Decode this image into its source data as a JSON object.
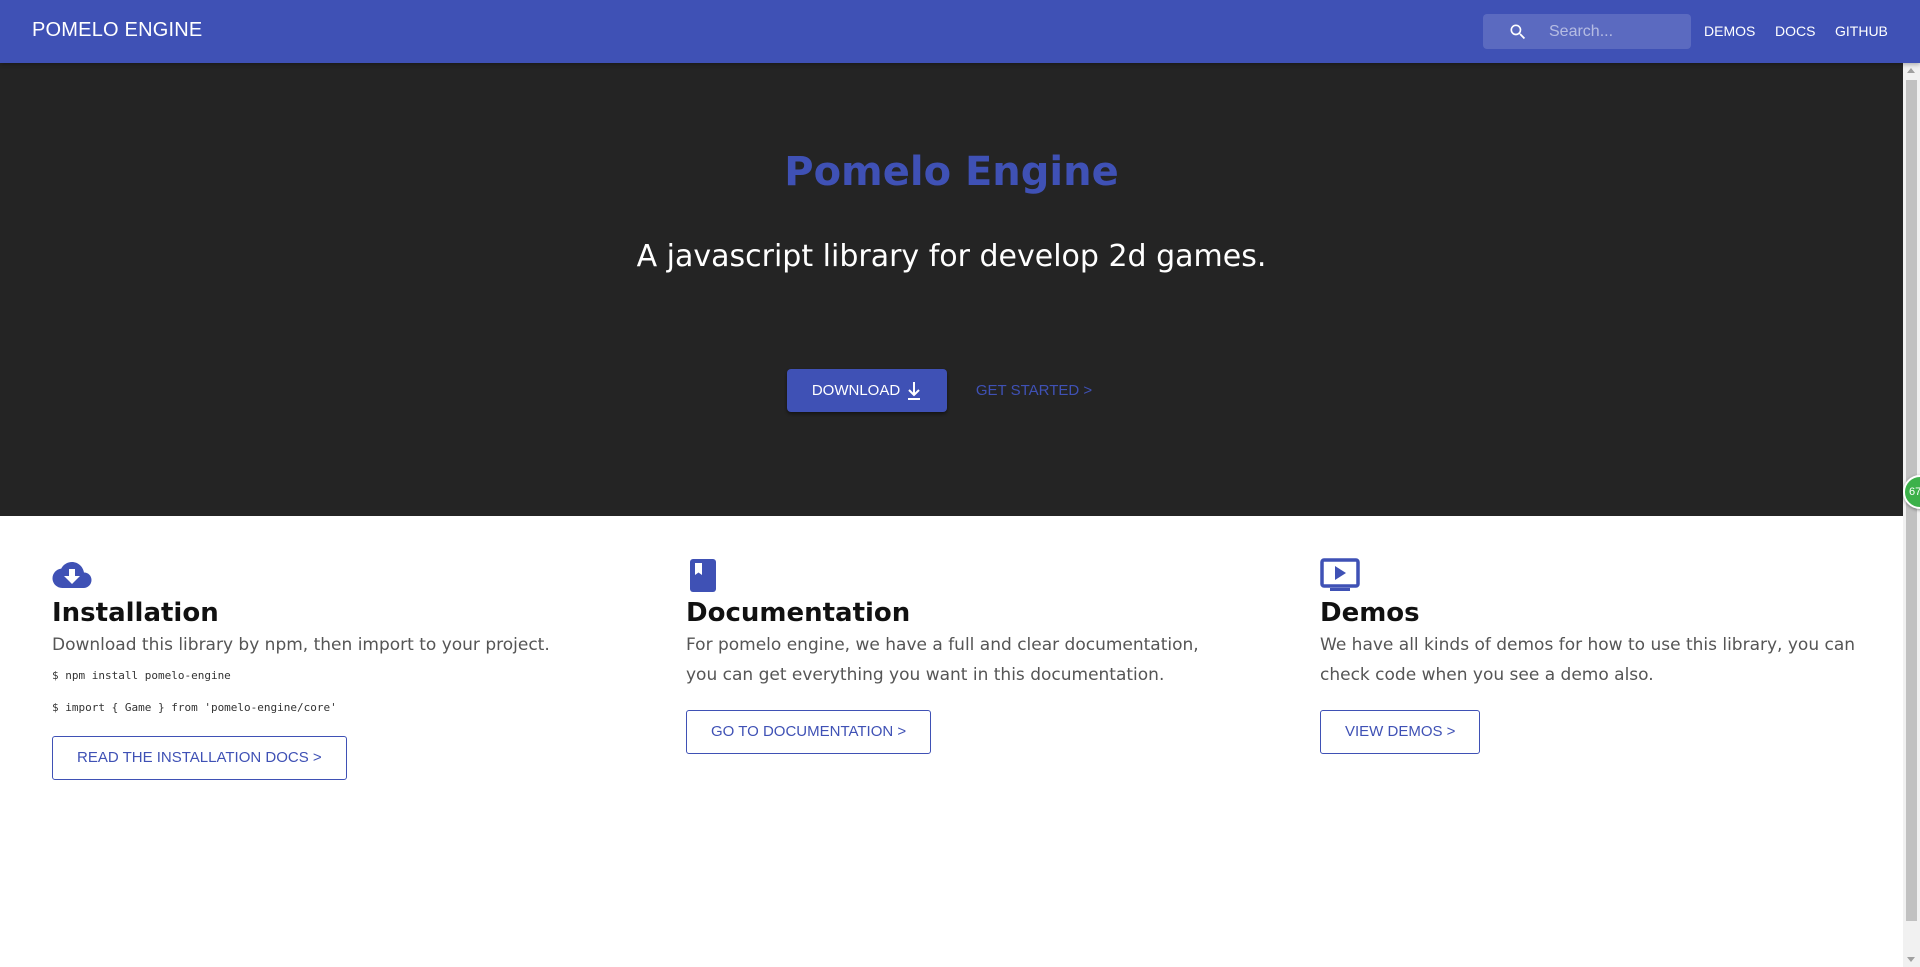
{
  "header": {
    "brand": "POMELO ENGINE",
    "search_placeholder": "Search...",
    "nav": [
      "DEMOS",
      "DOCS",
      "GITHUB"
    ]
  },
  "hero": {
    "title": "Pomelo Engine",
    "subtitle": "A javascript library for develop 2d games.",
    "download_label": "DOWNLOAD",
    "get_started_label": "GET STARTED >"
  },
  "features": [
    {
      "icon": "cloud-download-icon",
      "title": "Installation",
      "description": "Download this library by npm, then import to your project.",
      "code": [
        "$ npm install pomelo-engine",
        "$ import { Game } from 'pomelo-engine/core'"
      ],
      "button": "READ THE INSTALLATION DOCS >"
    },
    {
      "icon": "book-icon",
      "title": "Documentation",
      "description": "For pomelo engine, we have a full and clear documentation, you can get everything you want in this documentation.",
      "button": "GO TO DOCUMENTATION >"
    },
    {
      "icon": "play-screen-icon",
      "title": "Demos",
      "description": "We have all kinds of demos for how to use this library, you can check code when you see a demo also.",
      "button": "VIEW DEMOS >"
    }
  ],
  "floating_badge": "67",
  "colors": {
    "primary": "#3f51b5",
    "hero_bg": "#242424",
    "text": "#111111",
    "muted": "#555555"
  }
}
